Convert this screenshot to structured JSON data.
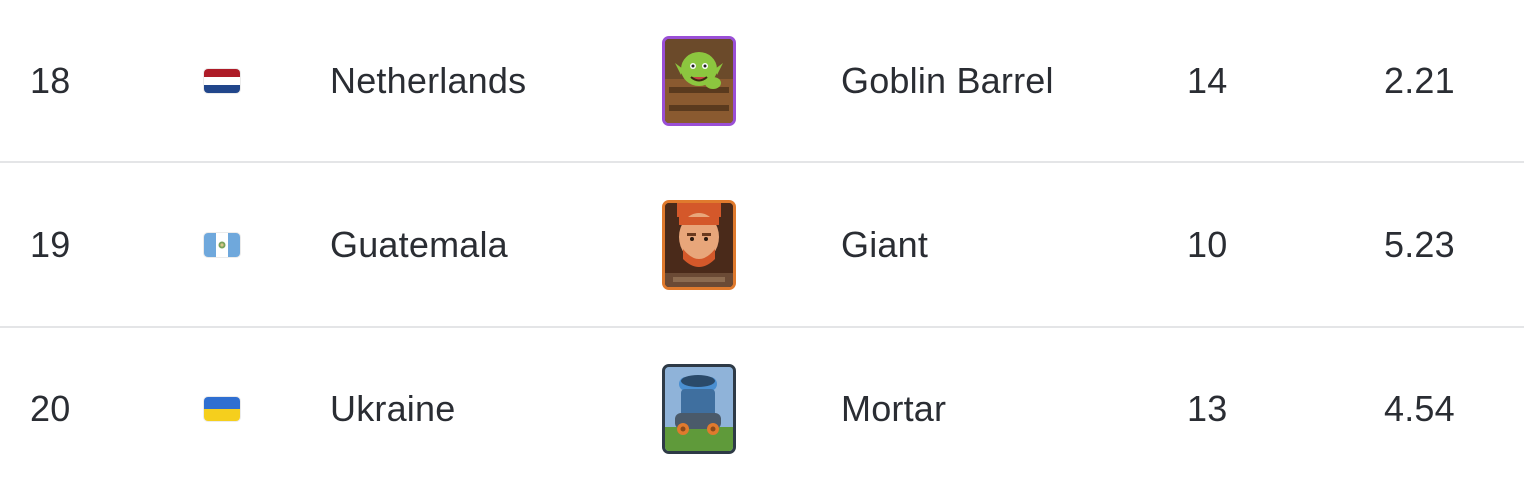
{
  "rows": [
    {
      "rank": "18",
      "flag_icon": "netherlands-flag-icon",
      "country": "Netherlands",
      "card_icon": "goblin-barrel-card-icon",
      "card_rarity_color": "#9a4fd6",
      "card_name": "Goblin Barrel",
      "level": "14",
      "elixir": "2.21"
    },
    {
      "rank": "19",
      "flag_icon": "guatemala-flag-icon",
      "country": "Guatemala",
      "card_icon": "giant-card-icon",
      "card_rarity_color": "#e07a2d",
      "card_name": "Giant",
      "level": "10",
      "elixir": "5.23"
    },
    {
      "rank": "20",
      "flag_icon": "ukraine-flag-icon",
      "country": "Ukraine",
      "card_icon": "mortar-card-icon",
      "card_rarity_color": "#2e3a46",
      "card_name": "Mortar",
      "level": "13",
      "elixir": "4.54"
    }
  ]
}
